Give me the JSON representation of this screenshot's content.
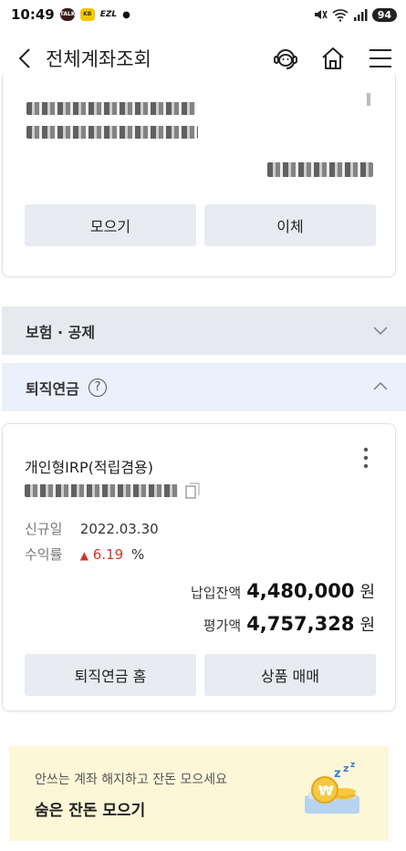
{
  "status_bar": {
    "time": "10:49",
    "notifications": [
      "TALK",
      "KB",
      "EZL"
    ],
    "battery": "94"
  },
  "header": {
    "title": "전체계좌조회"
  },
  "top_account": {
    "withdraw_button": "모으기",
    "transfer_button": "이체"
  },
  "sections": {
    "insurance": "보험 · 공제",
    "pension": "퇴직연금"
  },
  "irp_account": {
    "name": "개인형IRP(적립겸용)",
    "new_label": "신규일",
    "new_date": "2022.03.30",
    "yield_label": "수익률",
    "yield_arrow": "▲",
    "yield_value": "6.19",
    "yield_unit": "%",
    "paid_label": "납입잔액",
    "paid_value": "4,480,000",
    "eval_label": "평가액",
    "eval_value": "4,757,328",
    "currency": "원",
    "home_button": "퇴직연금 홈",
    "trade_button": "상품 매매"
  },
  "promo": {
    "subtitle": "안쓰는 계좌 해지하고 잔돈 모으세요",
    "title": "숨은 잔돈 모으기"
  },
  "colors": {
    "up": "#d0342c",
    "button_bg": "#e8ebef",
    "pension_bg": "#ebf1fc",
    "promo_bg": "#fdf7d8"
  }
}
